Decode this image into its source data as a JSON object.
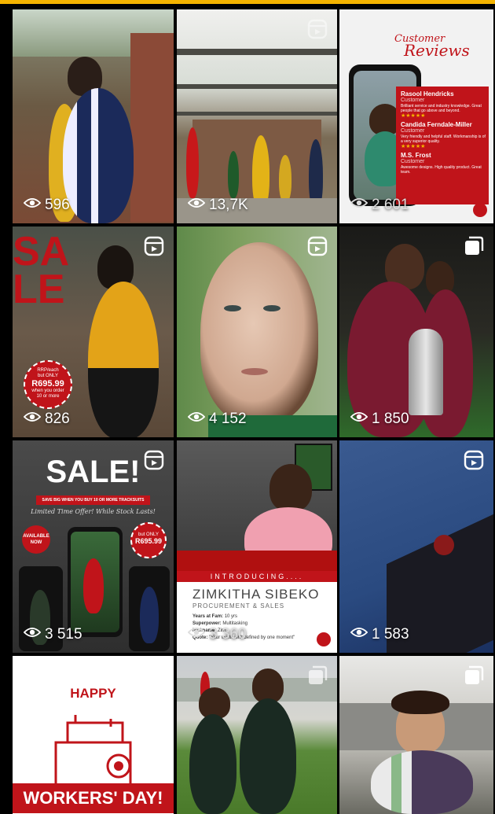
{
  "tiles": [
    {
      "views": "596",
      "type": "photo"
    },
    {
      "views": "13,7K",
      "type": "reel"
    },
    {
      "views": "2 601",
      "type": "photo",
      "reviews": {
        "title_line1": "Customer",
        "title_line2": "Reviews",
        "items": [
          {
            "name": "Rasool Hendricks",
            "role": "Customer",
            "text": "Brilliant service and industry knowledge. Great people that go above and beyond.",
            "stars": "★★★★★"
          },
          {
            "name": "Candida Ferndale-Miller",
            "role": "Customer",
            "text": "Very friendly and helpful staff. Workmanship is of a very superior quality.",
            "stars": "★★★★★"
          },
          {
            "name": "M.S. Frost",
            "role": "Customer",
            "text": "Awesome designs. High quality product. Great team.",
            "stars": "★★★★★"
          }
        ]
      }
    },
    {
      "views": "826",
      "type": "reel",
      "sale_word": "SALE",
      "badge": {
        "line1": "RRP/each",
        "line2": "but ONLY",
        "price": "R695.99",
        "line3": "when you order",
        "line4": "10 or more"
      }
    },
    {
      "views": "4 152",
      "type": "reel"
    },
    {
      "views": "1 850",
      "type": "carousel"
    },
    {
      "views": "3 515",
      "type": "reel",
      "headline": "SALE!",
      "banner": "SAVE BIG WHEN YOU BUY 10 OR MORE TRACKSUITS",
      "script": "Limited Time Offer! While Stock Lasts!",
      "available": "AVAILABLE NOW",
      "price_badge": {
        "line1": "but ONLY",
        "price": "R695.99"
      }
    },
    {
      "views": "3 360",
      "type": "photo",
      "introducing": "INTRODUCING....",
      "name": "ZIMKITHA SIBEKO",
      "role": "PROCUREMENT & SALES",
      "facts": [
        {
          "label": "Years at Fam:",
          "value": "10 yrs"
        },
        {
          "label": "Superpower:",
          "value": "Multitasking"
        },
        {
          "label": "Nickname:",
          "value": "Zim"
        },
        {
          "label": "Quote:",
          "value": "\"Your worth isn't defined by one moment\""
        }
      ]
    },
    {
      "views": "1 583",
      "type": "reel"
    },
    {
      "views": "",
      "type": "photo",
      "happy": "HAPPY",
      "workers": "WORKERS' DAY!"
    },
    {
      "views": "",
      "type": "carousel"
    },
    {
      "views": "",
      "type": "carousel"
    }
  ],
  "colors": {
    "accent_bar": "#f5b400",
    "brand_red": "#c0141a",
    "icon_white": "#ffffff"
  },
  "icons": {
    "views": "eye-icon",
    "reel": "reel-icon",
    "carousel": "carousel-icon"
  }
}
